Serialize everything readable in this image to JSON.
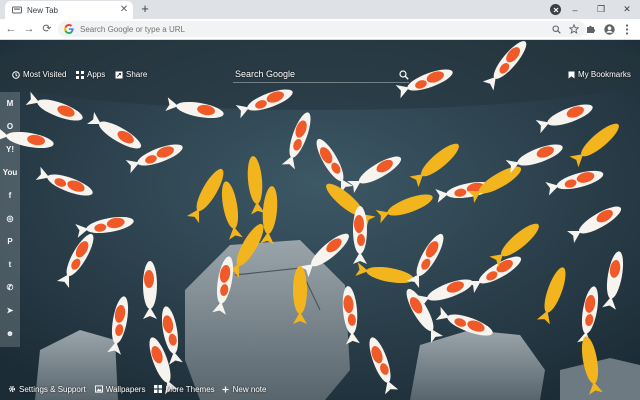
{
  "browser": {
    "tab": {
      "title": "New Tab",
      "close_glyph": "✕"
    },
    "new_tab_glyph": "+",
    "omnibox": {
      "placeholder": "Search Google or type a URL"
    },
    "window_controls": {
      "minimize": "–",
      "restore": "❐",
      "close": "✕"
    },
    "nav": {
      "back": "←",
      "forward": "→",
      "reload": "⟳"
    }
  },
  "page": {
    "top_links": {
      "most_visited": "Most Visited",
      "apps": "Apps",
      "share": "Share",
      "bookmarks": "My Bookmarks"
    },
    "search": {
      "placeholder": "Search Google"
    },
    "social": [
      {
        "name": "gmail-icon",
        "glyph": "M"
      },
      {
        "name": "outlook-icon",
        "glyph": "O"
      },
      {
        "name": "yahoo-icon",
        "glyph": "Y!"
      },
      {
        "name": "youtube-icon",
        "glyph": "You"
      },
      {
        "name": "facebook-icon",
        "glyph": "f"
      },
      {
        "name": "instagram-icon",
        "glyph": "◎"
      },
      {
        "name": "pinterest-icon",
        "glyph": "P"
      },
      {
        "name": "twitter-icon",
        "glyph": "t"
      },
      {
        "name": "whatsapp-icon",
        "glyph": "✆"
      },
      {
        "name": "telegram-icon",
        "glyph": "➤"
      },
      {
        "name": "reddit-icon",
        "glyph": "☻"
      }
    ],
    "bottom_links": {
      "settings": "Settings & Support",
      "wallpapers": "Wallpapers",
      "more_themes": "More Themes",
      "new_note": "New note"
    }
  },
  "colors": {
    "tabstrip": "#dee1e6",
    "water": "#2b3d48",
    "koi_orange": "#f05a28",
    "koi_gold": "#f2b51e",
    "koi_white": "#f7f3ee",
    "rock": "#7d8a92"
  }
}
